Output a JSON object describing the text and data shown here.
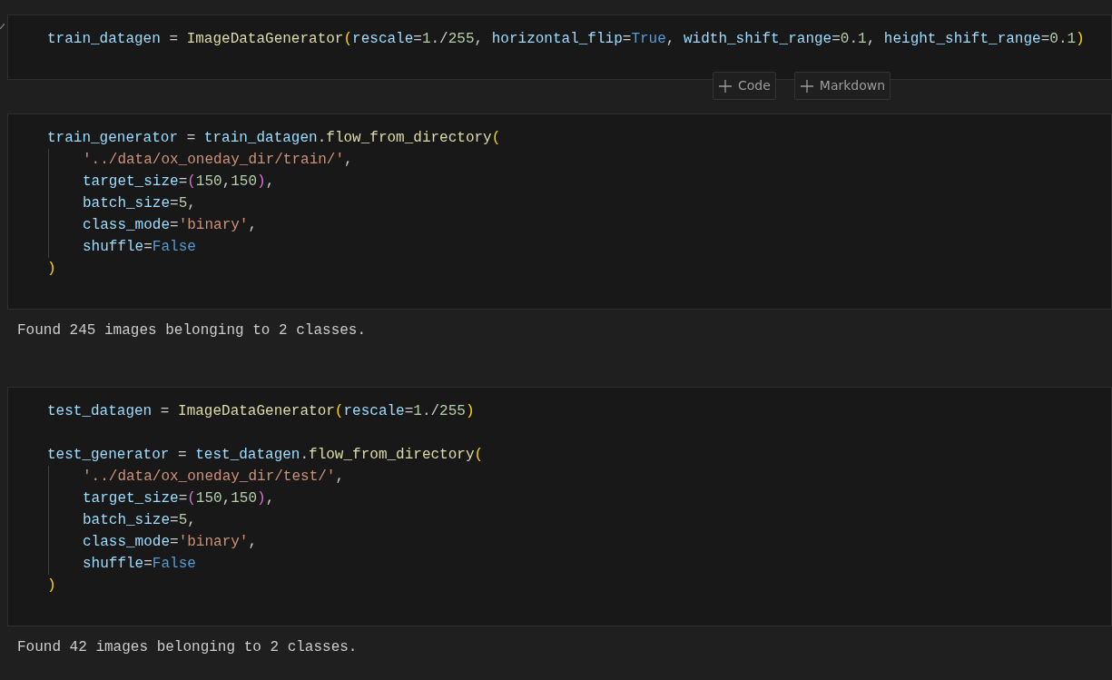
{
  "cells": [
    {
      "statements": [
        {
          "tokens": [
            {
              "text": "train_datagen",
              "kind": "var"
            },
            {
              "text": " = ",
              "kind": "plain"
            },
            {
              "text": "ImageDataGenerator",
              "kind": "func"
            },
            {
              "text": "(",
              "kind": "p1"
            },
            {
              "text": "rescale",
              "kind": "var"
            },
            {
              "text": "=",
              "kind": "plain"
            },
            {
              "text": "1.",
              "kind": "num"
            },
            {
              "text": "/",
              "kind": "plain"
            },
            {
              "text": "255",
              "kind": "num"
            },
            {
              "text": ", ",
              "kind": "plain"
            },
            {
              "text": "horizontal_flip",
              "kind": "var"
            },
            {
              "text": "=",
              "kind": "plain"
            },
            {
              "text": "True",
              "kind": "kw"
            },
            {
              "text": ", ",
              "kind": "plain"
            },
            {
              "text": "width_shift_range",
              "kind": "var"
            },
            {
              "text": "=",
              "kind": "plain"
            },
            {
              "text": "0.1",
              "kind": "num"
            },
            {
              "text": ", ",
              "kind": "plain"
            },
            {
              "text": "height_shift_range",
              "kind": "var"
            },
            {
              "text": "=",
              "kind": "plain"
            },
            {
              "text": "0.1",
              "kind": "num"
            },
            {
              "text": ")",
              "kind": "p1"
            }
          ]
        }
      ],
      "toolbar": [
        {
          "label": "Code"
        },
        {
          "label": "Markdown"
        }
      ]
    },
    {
      "statements": [
        {
          "tokens": [
            {
              "text": "train_generator",
              "kind": "var"
            },
            {
              "text": " = ",
              "kind": "plain"
            },
            {
              "text": "train_datagen",
              "kind": "var"
            },
            {
              "text": ".",
              "kind": "plain"
            },
            {
              "text": "flow_from_directory",
              "kind": "func"
            },
            {
              "text": "(",
              "kind": "p1"
            }
          ],
          "children": [
            {
              "tokens": [
                {
                  "text": "'../data/ox_oneday_dir/train/'",
                  "kind": "str"
                },
                {
                  "text": ",",
                  "kind": "plain"
                }
              ]
            },
            {
              "tokens": [
                {
                  "text": "target_size",
                  "kind": "var"
                },
                {
                  "text": "=",
                  "kind": "plain"
                },
                {
                  "text": "(",
                  "kind": "p2"
                },
                {
                  "text": "150",
                  "kind": "num"
                },
                {
                  "text": ",",
                  "kind": "plain"
                },
                {
                  "text": "150",
                  "kind": "num"
                },
                {
                  "text": ")",
                  "kind": "p2"
                },
                {
                  "text": ",",
                  "kind": "plain"
                }
              ]
            },
            {
              "tokens": [
                {
                  "text": "batch_size",
                  "kind": "var"
                },
                {
                  "text": "=",
                  "kind": "plain"
                },
                {
                  "text": "5",
                  "kind": "num"
                },
                {
                  "text": ",",
                  "kind": "plain"
                }
              ]
            },
            {
              "tokens": [
                {
                  "text": "class_mode",
                  "kind": "var"
                },
                {
                  "text": "=",
                  "kind": "plain"
                },
                {
                  "text": "'binary'",
                  "kind": "str"
                },
                {
                  "text": ",",
                  "kind": "plain"
                }
              ]
            },
            {
              "tokens": [
                {
                  "text": "shuffle",
                  "kind": "var"
                },
                {
                  "text": "=",
                  "kind": "plain"
                },
                {
                  "text": "False",
                  "kind": "kw"
                }
              ]
            }
          ],
          "close": [
            {
              "text": ")",
              "kind": "p1"
            }
          ]
        }
      ],
      "output": "Found 245 images belonging to 2 classes."
    },
    {
      "statements": [
        {
          "tokens": [
            {
              "text": "test_datagen",
              "kind": "var"
            },
            {
              "text": " = ",
              "kind": "plain"
            },
            {
              "text": "ImageDataGenerator",
              "kind": "func"
            },
            {
              "text": "(",
              "kind": "p1"
            },
            {
              "text": "rescale",
              "kind": "var"
            },
            {
              "text": "=",
              "kind": "plain"
            },
            {
              "text": "1.",
              "kind": "num"
            },
            {
              "text": "/",
              "kind": "plain"
            },
            {
              "text": "255",
              "kind": "num"
            },
            {
              "text": ")",
              "kind": "p1"
            }
          ]
        },
        {
          "tokens": [
            {
              "text": "test_generator",
              "kind": "var"
            },
            {
              "text": " = ",
              "kind": "plain"
            },
            {
              "text": "test_datagen",
              "kind": "var"
            },
            {
              "text": ".",
              "kind": "plain"
            },
            {
              "text": "flow_from_directory",
              "kind": "func"
            },
            {
              "text": "(",
              "kind": "p1"
            }
          ],
          "children": [
            {
              "tokens": [
                {
                  "text": "'../data/ox_oneday_dir/test/'",
                  "kind": "str"
                },
                {
                  "text": ",",
                  "kind": "plain"
                }
              ]
            },
            {
              "tokens": [
                {
                  "text": "target_size",
                  "kind": "var"
                },
                {
                  "text": "=",
                  "kind": "plain"
                },
                {
                  "text": "(",
                  "kind": "p2"
                },
                {
                  "text": "150",
                  "kind": "num"
                },
                {
                  "text": ",",
                  "kind": "plain"
                },
                {
                  "text": "150",
                  "kind": "num"
                },
                {
                  "text": ")",
                  "kind": "p2"
                },
                {
                  "text": ",",
                  "kind": "plain"
                }
              ]
            },
            {
              "tokens": [
                {
                  "text": "batch_size",
                  "kind": "var"
                },
                {
                  "text": "=",
                  "kind": "plain"
                },
                {
                  "text": "5",
                  "kind": "num"
                },
                {
                  "text": ",",
                  "kind": "plain"
                }
              ]
            },
            {
              "tokens": [
                {
                  "text": "class_mode",
                  "kind": "var"
                },
                {
                  "text": "=",
                  "kind": "plain"
                },
                {
                  "text": "'binary'",
                  "kind": "str"
                },
                {
                  "text": ",",
                  "kind": "plain"
                }
              ]
            },
            {
              "tokens": [
                {
                  "text": "shuffle",
                  "kind": "var"
                },
                {
                  "text": "=",
                  "kind": "plain"
                },
                {
                  "text": "False",
                  "kind": "kw"
                }
              ]
            }
          ],
          "close": [
            {
              "text": ")",
              "kind": "p1"
            }
          ]
        }
      ],
      "output": "Found 42 images belonging to 2 classes."
    }
  ]
}
